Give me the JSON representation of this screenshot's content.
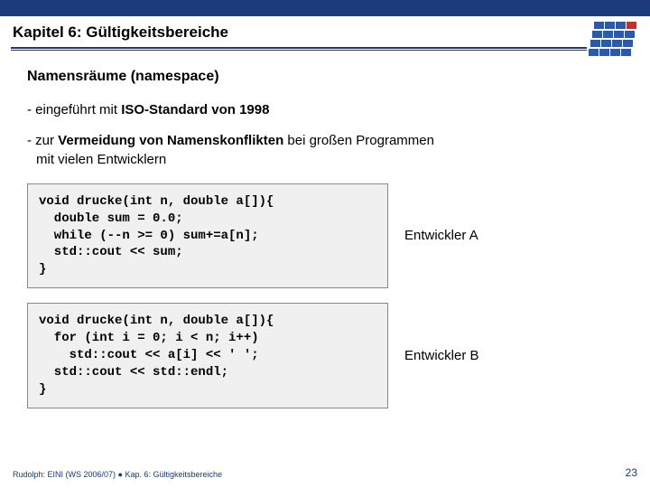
{
  "header": {
    "chapter_title": "Kapitel 6: Gültigkeitsbereiche"
  },
  "section": {
    "heading": "Namensräume (namespace)",
    "bullet1_prefix": "- eingeführt mit ",
    "bullet1_bold": "ISO-Standard von 1998",
    "bullet2_prefix": "- zur ",
    "bullet2_bold": "Vermeidung von Namenskonflikten",
    "bullet2_rest_line1": " bei großen Programmen",
    "bullet2_rest_line2": "mit vielen Entwicklern"
  },
  "code_a": {
    "text": "void drucke(int n, double a[]){\n  double sum = 0.0;\n  while (--n >= 0) sum+=a[n];\n  std::cout << sum;\n}",
    "label": "Entwickler A"
  },
  "code_b": {
    "text": "void drucke(int n, double a[]){\n  for (int i = 0; i < n; i++)\n    std::cout << a[i] << ' ';\n  std::cout << std::endl;\n}",
    "label": "Entwickler B"
  },
  "footer": {
    "left": "Rudolph: EINI (WS 2006/07)  ●  Kap. 6: Gültigkeitsbereiche",
    "page": "23"
  },
  "logo": {
    "cells": [
      {
        "t": 0,
        "l": 8,
        "c": "#2d5aa8"
      },
      {
        "t": 0,
        "l": 20,
        "c": "#2d5aa8"
      },
      {
        "t": 0,
        "l": 32,
        "c": "#2d5aa8"
      },
      {
        "t": 0,
        "l": 44,
        "c": "#c0302c"
      },
      {
        "t": 10,
        "l": 6,
        "c": "#2d5aa8"
      },
      {
        "t": 10,
        "l": 18,
        "c": "#2d5aa8"
      },
      {
        "t": 10,
        "l": 30,
        "c": "#2d5aa8"
      },
      {
        "t": 10,
        "l": 42,
        "c": "#2d5aa8"
      },
      {
        "t": 20,
        "l": 4,
        "c": "#2d5aa8"
      },
      {
        "t": 20,
        "l": 16,
        "c": "#2d5aa8"
      },
      {
        "t": 20,
        "l": 28,
        "c": "#2d5aa8"
      },
      {
        "t": 20,
        "l": 40,
        "c": "#2d5aa8"
      },
      {
        "t": 30,
        "l": 2,
        "c": "#2d5aa8"
      },
      {
        "t": 30,
        "l": 14,
        "c": "#2d5aa8"
      },
      {
        "t": 30,
        "l": 26,
        "c": "#2d5aa8"
      },
      {
        "t": 30,
        "l": 38,
        "c": "#2d5aa8"
      }
    ]
  }
}
